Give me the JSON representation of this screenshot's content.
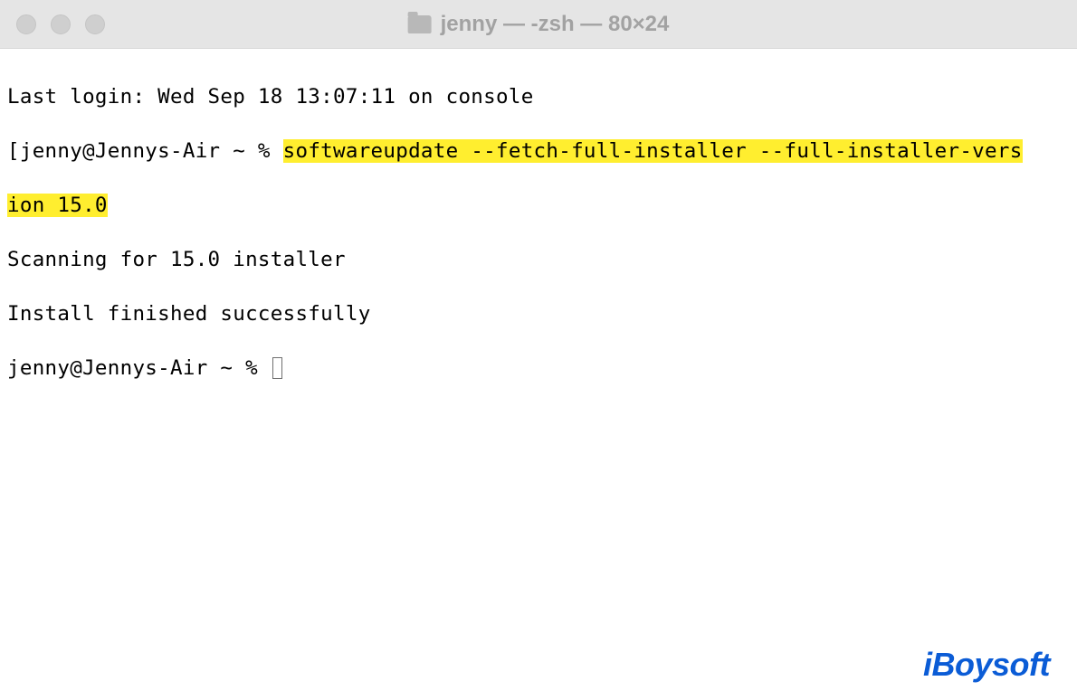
{
  "titlebar": {
    "title": "jenny — -zsh — 80×24"
  },
  "terminal": {
    "last_login": "Last login: Wed Sep 18 13:07:11 on console",
    "prompt1_prefix": "[jenny@Jennys-Air ~ % ",
    "command_part1": "softwareupdate --fetch-full-installer --full-installer-vers",
    "command_part2": "ion 15.0",
    "scanning": "Scanning for 15.0 installer",
    "finished": "Install finished successfully",
    "prompt2": "jenny@Jennys-Air ~ % "
  },
  "watermark": "iBoysoft"
}
